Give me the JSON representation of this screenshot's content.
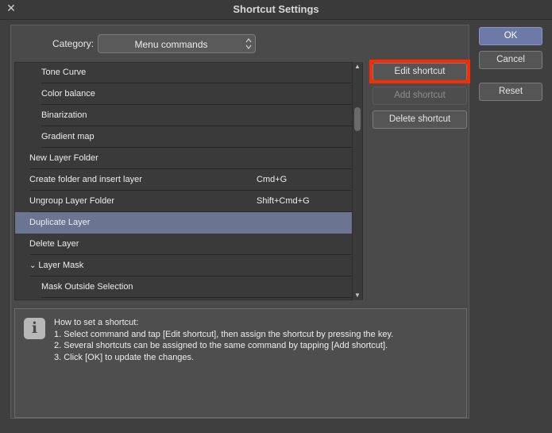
{
  "window": {
    "title": "Shortcut Settings"
  },
  "category": {
    "label": "Category:",
    "value": "Menu commands"
  },
  "rows": [
    {
      "name": "Tone Curve",
      "shortcut": "",
      "indent": 2,
      "expand": false,
      "selected": false
    },
    {
      "name": "Color balance",
      "shortcut": "",
      "indent": 2,
      "expand": false,
      "selected": false
    },
    {
      "name": "Binarization",
      "shortcut": "",
      "indent": 2,
      "expand": false,
      "selected": false
    },
    {
      "name": "Gradient map",
      "shortcut": "",
      "indent": 2,
      "expand": false,
      "selected": false
    },
    {
      "name": "New Layer Folder",
      "shortcut": "",
      "indent": 1,
      "expand": false,
      "selected": false
    },
    {
      "name": "Create folder and insert layer",
      "shortcut": "Cmd+G",
      "indent": 1,
      "expand": false,
      "selected": false
    },
    {
      "name": "Ungroup Layer Folder",
      "shortcut": "Shift+Cmd+G",
      "indent": 1,
      "expand": false,
      "selected": false
    },
    {
      "name": "Duplicate Layer",
      "shortcut": "",
      "indent": 1,
      "expand": false,
      "selected": true
    },
    {
      "name": "Delete Layer",
      "shortcut": "",
      "indent": 1,
      "expand": false,
      "selected": false
    },
    {
      "name": "Layer Mask",
      "shortcut": "",
      "indent": 1,
      "expand": true,
      "selected": false
    },
    {
      "name": "Mask Outside Selection",
      "shortcut": "",
      "indent": 2,
      "expand": false,
      "selected": false
    }
  ],
  "buttons": {
    "edit_shortcut": "Edit shortcut",
    "add_shortcut": "Add shortcut",
    "delete_shortcut": "Delete shortcut",
    "ok": "OK",
    "cancel": "Cancel",
    "reset": "Reset"
  },
  "help": {
    "heading": "How to set a shortcut:",
    "line1": "1. Select command and tap [Edit shortcut], then assign the shortcut by pressing the key.",
    "line2": "2. Several shortcuts can be assigned to the same command by tapping [Add shortcut].",
    "line3": "3. Click [OK] to update the changes."
  },
  "colors": {
    "highlight": "#ff2a00",
    "selected_row": "#6b7592",
    "primary_button": "#6d7aa8"
  }
}
